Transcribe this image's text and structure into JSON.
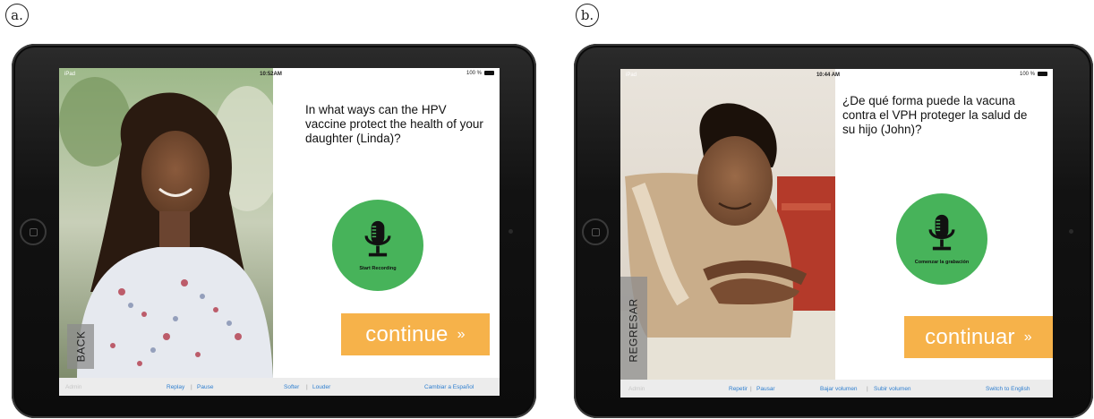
{
  "panels": [
    {
      "label": "a.",
      "status": {
        "left": "iPad",
        "time": "10:52AM",
        "battery": "100 %"
      },
      "question": "In what ways can the HPV vaccine protect the health of your daughter (Linda)?",
      "mic_label": "Start Recording",
      "continue_label": "continue",
      "continue_chevron": "»",
      "back_label": "BACK",
      "toolbar": {
        "admin": "Admin",
        "replay": "Replay",
        "pause": "Pause",
        "softer": "Softer",
        "louder": "Louder",
        "language": "Cambiar a Español",
        "sep": "|"
      }
    },
    {
      "label": "b.",
      "status": {
        "left": "iPad",
        "time": "10:44 AM",
        "battery": "100 %"
      },
      "question": "¿De qué forma puede la vacuna contra el VPH proteger la salud de su hijo (John)?",
      "mic_label": "Comenzar la grabación",
      "continue_label": "continuar",
      "continue_chevron": "»",
      "back_label": "REGRESAR",
      "toolbar": {
        "admin": "Admin",
        "replay": "Repetir",
        "pause": "Pausar",
        "softer": "Bajar volumen",
        "louder": "Subir volumen",
        "language": "Switch to English",
        "sep": "|"
      }
    }
  ],
  "colors": {
    "mic_green": "#47b35a",
    "continue_orange": "#f6b24a",
    "toolbar_link": "#2f7fd0",
    "device_bezel": "#111111"
  },
  "icons": {
    "mic": "microphone-icon",
    "home": "home-button-icon",
    "battery": "battery-icon",
    "wifi": "wifi-icon"
  }
}
